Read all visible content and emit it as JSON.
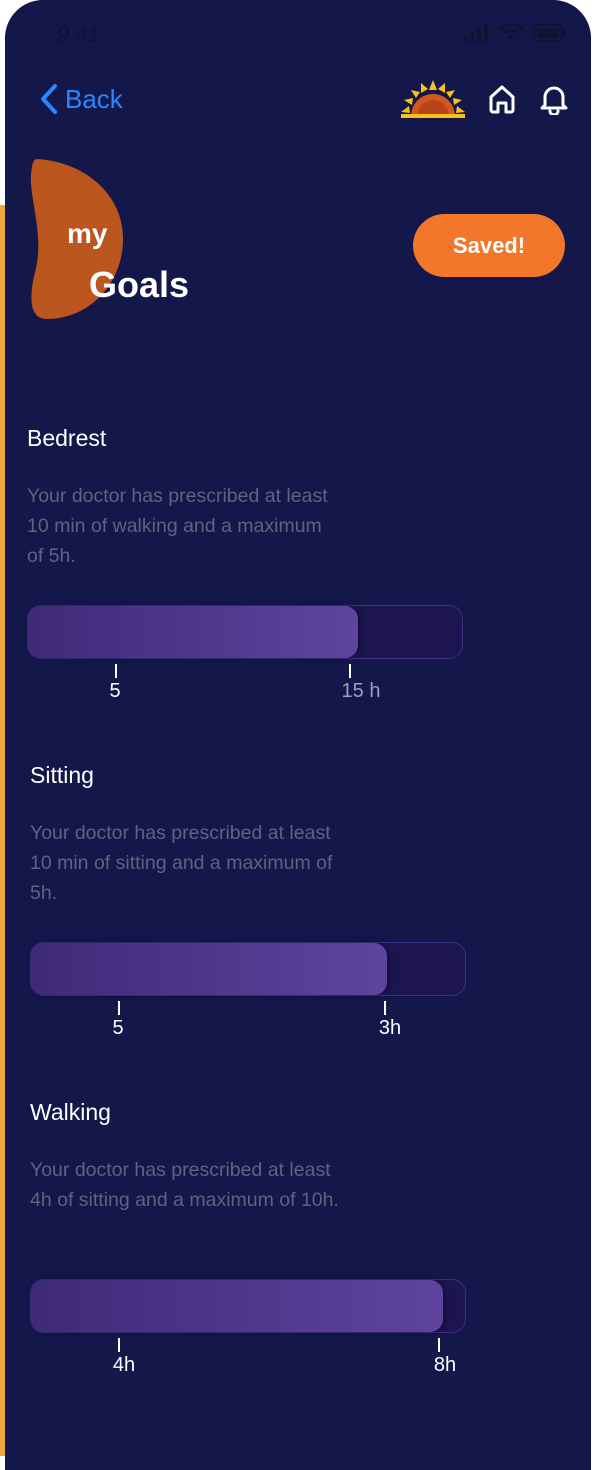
{
  "status_bar": {
    "time": "9:41"
  },
  "nav": {
    "back_label": "Back"
  },
  "header": {
    "title_small": "my",
    "title_large": "Goals",
    "saved_label": "Saved!"
  },
  "colors": {
    "background": "#13174a",
    "accent": "#f2772b",
    "back_link": "#2b87ff",
    "bar_fill": "#5e449e"
  },
  "goals": [
    {
      "title": "Bedrest",
      "description": "Your doctor has prescribed at least 10 min of walking and a maximum of 5h.",
      "progress": 0.76,
      "min_label": "5",
      "max_label": "15 h"
    },
    {
      "title": "Sitting",
      "description": "Your doctor has prescribed at least 10 min of sitting and a maximum of 5h.",
      "progress": 0.82,
      "min_label": "5",
      "max_label": "3h"
    },
    {
      "title": "Walking",
      "description": "Your doctor has prescribed at least 4h of sitting and a maximum of 10h.",
      "progress": 0.95,
      "min_label": "4h",
      "max_label": "8h"
    }
  ]
}
